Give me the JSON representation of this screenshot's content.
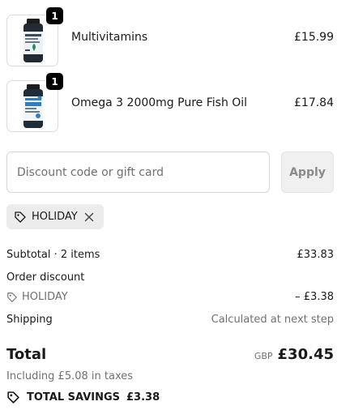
{
  "items": [
    {
      "name": "Multivitamins",
      "price": "£15.99",
      "quantity": "1",
      "image_icon": "vitamin-bottle-icon",
      "label_color": "#3a4a5a"
    },
    {
      "name": "Omega 3 2000mg Pure Fish Oil",
      "price": "£17.84",
      "quantity": "1",
      "image_icon": "omega3-bottle-icon",
      "label_color": "#2f7fc1"
    }
  ],
  "discount": {
    "placeholder": "Discount code or gift card",
    "value": "",
    "apply_label": "Apply"
  },
  "applied_code": {
    "code": "HOLIDAY",
    "icon": "tag-icon",
    "remove_icon": "close-icon"
  },
  "summary": {
    "subtotal_label": "Subtotal · 2 items",
    "subtotal_value": "£33.83",
    "order_discount_label": "Order discount",
    "discount_code": "HOLIDAY",
    "discount_value": "– £3.38",
    "shipping_label": "Shipping",
    "shipping_value": "Calculated at next step"
  },
  "total": {
    "label": "Total",
    "currency": "GBP",
    "amount": "£30.45",
    "taxes_note": "Including £5.08 in taxes"
  },
  "savings": {
    "label": "TOTAL SAVINGS",
    "amount": "£3.38"
  },
  "colors": {
    "text": "#1a1a1a",
    "muted": "#707070",
    "badge_bg": "#000000",
    "chip_bg": "#ececec",
    "apply_bg": "#f0f0f0"
  }
}
